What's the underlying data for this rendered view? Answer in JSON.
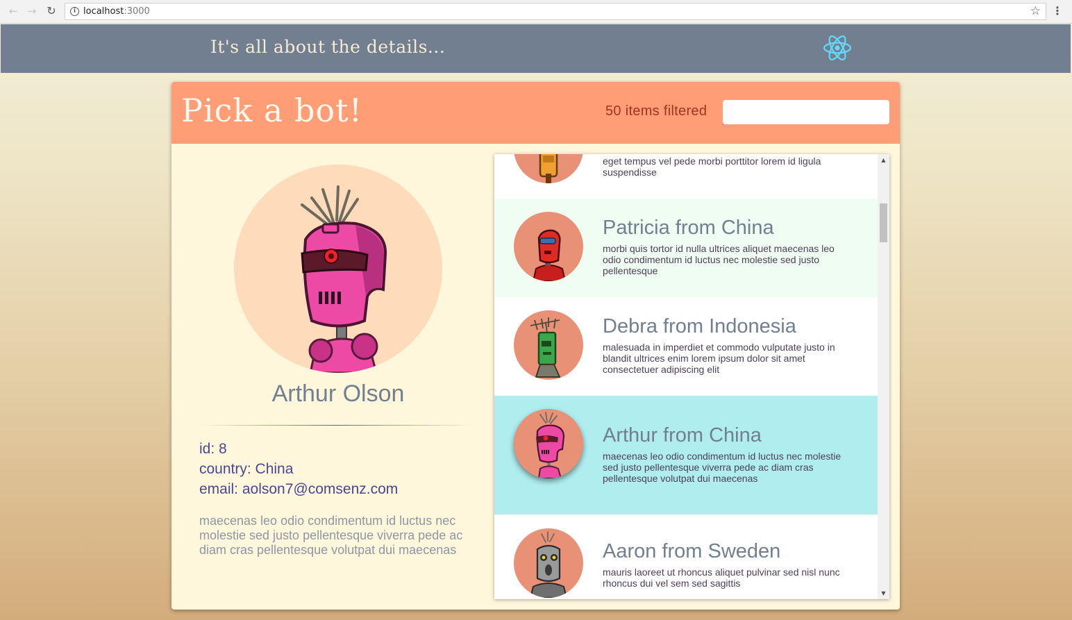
{
  "browser": {
    "url_host": "localhost",
    "url_port": ":3000"
  },
  "header": {
    "tagline": "It's all about the details..."
  },
  "card": {
    "title": "Pick a bot!",
    "filter_count": "50 items filtered",
    "filter_value": ""
  },
  "detail": {
    "name": "Arthur Olson",
    "id_line": "id: 8",
    "country_line": "country: China",
    "email_line": "email: aolson7@comsenz.com",
    "description": "maecenas leo odio condimentum id luctus nec molestie sed justo pellentesque viverra pede ac diam cras pellentesque volutpat dui maecenas"
  },
  "list": {
    "items": [
      {
        "title": "",
        "description": "eget tempus vel pede morbi porttitor lorem id ligula suspendisse",
        "bot_color": "#f0a030",
        "selected": false
      },
      {
        "title": "Patricia from China",
        "description": "morbi quis tortor id nulla ultrices aliquet maecenas leo odio condimentum id luctus nec molestie sed justo pellentesque",
        "bot_color": "#e02a24",
        "selected": false
      },
      {
        "title": "Debra from Indonesia",
        "description": "malesuada in imperdiet et commodo vulputate justo in blandit ultrices enim lorem ipsum dolor sit amet consectetuer adipiscing elit",
        "bot_color": "#3aa84a",
        "selected": false
      },
      {
        "title": "Arthur from China",
        "description": "maecenas leo odio condimentum id luctus nec molestie sed justo pellentesque viverra pede ac diam cras pellentesque volutpat dui maecenas",
        "bot_color": "#ec4aa4",
        "selected": true
      },
      {
        "title": "Aaron from Sweden",
        "description": "mauris laoreet ut rhoncus aliquet pulvinar sed nisl nunc rhoncus dui vel sem sed sagittis",
        "bot_color": "#8e8e8e",
        "selected": false
      }
    ]
  },
  "colors": {
    "header_bg": "#717f90",
    "card_header_bg": "#fe9d76",
    "card_bg": "#fff7dc",
    "row_alt_bg": "#f0fdf2",
    "row_selected_bg": "#afedef",
    "text_slate": "#717f90",
    "text_indigo": "#4b4690",
    "react_logo": "#61dafb"
  }
}
